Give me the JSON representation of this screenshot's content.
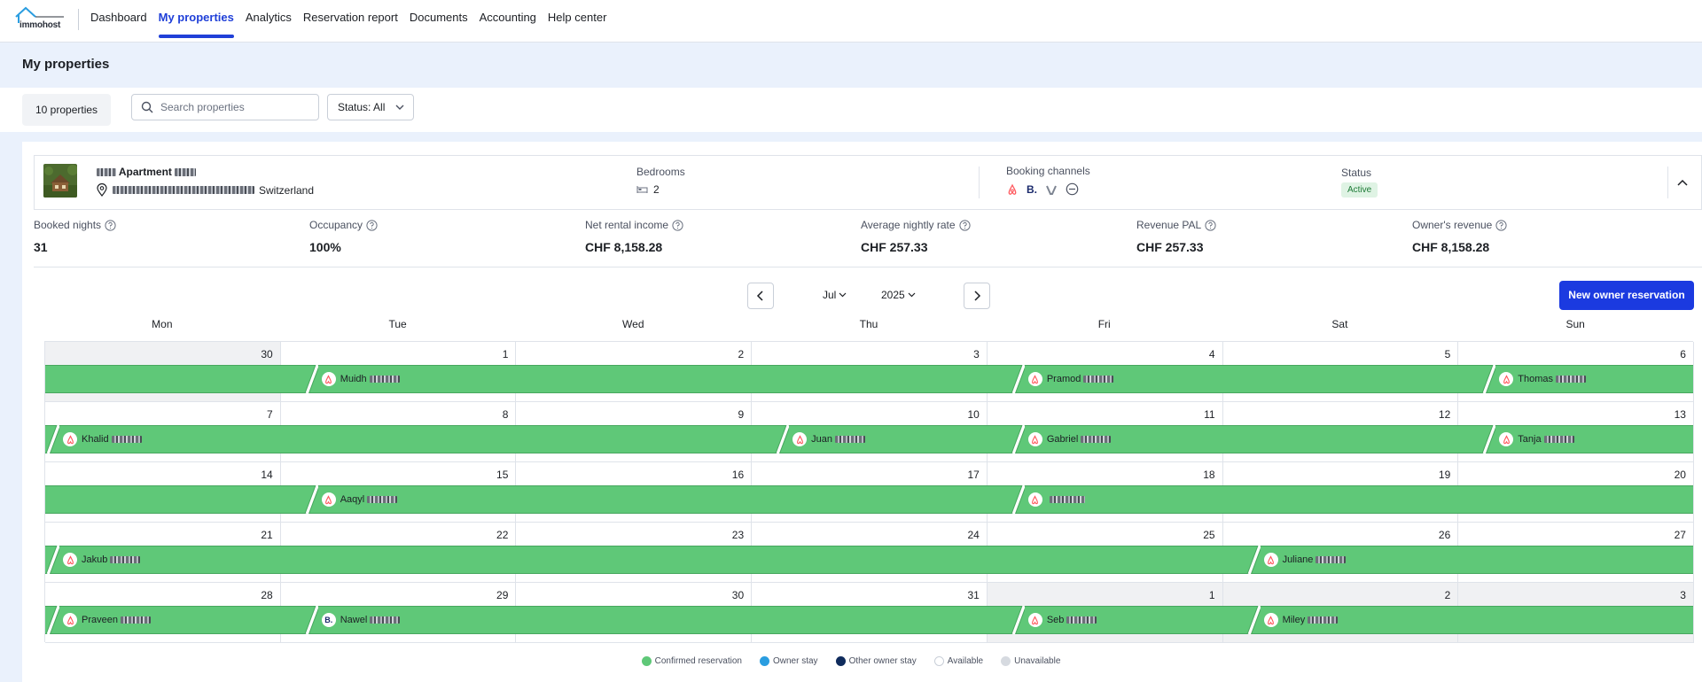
{
  "nav": {
    "logo_text": "immohost",
    "items": [
      {
        "label": "Dashboard",
        "active": false
      },
      {
        "label": "My properties",
        "active": true
      },
      {
        "label": "Analytics",
        "active": false
      },
      {
        "label": "Reservation report",
        "active": false
      },
      {
        "label": "Documents",
        "active": false
      },
      {
        "label": "Accounting",
        "active": false
      },
      {
        "label": "Help center",
        "active": false
      }
    ]
  },
  "page": {
    "title": "My properties"
  },
  "toolbar": {
    "count_label": "10 properties",
    "search_placeholder": "Search properties",
    "status_filter": "Status: All"
  },
  "property": {
    "name": "Apartment",
    "country": "Switzerland",
    "bedrooms_label": "Bedrooms",
    "bedrooms": "2",
    "channels_label": "Booking channels",
    "channels": [
      "airbnb-icon",
      "booking-icon",
      "vrbo-icon",
      "other-channel-icon"
    ],
    "channel_booking_letter": "B.",
    "status_label": "Status",
    "status": "Active"
  },
  "metrics": [
    {
      "label": "Booked nights",
      "value": "31"
    },
    {
      "label": "Occupancy",
      "value": "100%"
    },
    {
      "label": "Net rental income",
      "value": "CHF 8,158.28"
    },
    {
      "label": "Average nightly rate",
      "value": "CHF 257.33"
    },
    {
      "label": "Revenue PAL",
      "value": "CHF 257.33"
    },
    {
      "label": "Owner's revenue",
      "value": "CHF 8,158.28"
    }
  ],
  "calendar": {
    "month": "Jul",
    "year": "2025",
    "new_reservation_label": "New owner reservation",
    "weekdays": [
      "Mon",
      "Tue",
      "Wed",
      "Thu",
      "Fri",
      "Sat",
      "Sun"
    ],
    "weeks": [
      [
        {
          "d": "30",
          "out": true
        },
        {
          "d": "1"
        },
        {
          "d": "2"
        },
        {
          "d": "3"
        },
        {
          "d": "4"
        },
        {
          "d": "5"
        },
        {
          "d": "6"
        }
      ],
      [
        {
          "d": "7"
        },
        {
          "d": "8"
        },
        {
          "d": "9"
        },
        {
          "d": "10"
        },
        {
          "d": "11"
        },
        {
          "d": "12"
        },
        {
          "d": "13"
        }
      ],
      [
        {
          "d": "14"
        },
        {
          "d": "15"
        },
        {
          "d": "16"
        },
        {
          "d": "17"
        },
        {
          "d": "18"
        },
        {
          "d": "19"
        },
        {
          "d": "20"
        }
      ],
      [
        {
          "d": "21"
        },
        {
          "d": "22"
        },
        {
          "d": "23"
        },
        {
          "d": "24"
        },
        {
          "d": "25"
        },
        {
          "d": "26"
        },
        {
          "d": "27"
        }
      ],
      [
        {
          "d": "28"
        },
        {
          "d": "29"
        },
        {
          "d": "30"
        },
        {
          "d": "31"
        },
        {
          "d": "1",
          "out": true
        },
        {
          "d": "2",
          "out": true
        },
        {
          "d": "3",
          "out": true
        }
      ]
    ],
    "reservations": [
      {
        "week": 0,
        "startCol": 1,
        "guest": "Muidh",
        "channel": "airbnb"
      },
      {
        "week": 0,
        "startCol": 4,
        "guest": "Pramod",
        "channel": "airbnb"
      },
      {
        "week": 0,
        "startCol": 6,
        "guest": "Thomas",
        "channel": "airbnb"
      },
      {
        "week": 1,
        "startCol": 0,
        "guest": "Khalid",
        "channel": "airbnb"
      },
      {
        "week": 1,
        "startCol": 3,
        "guest": "Juan",
        "channel": "airbnb"
      },
      {
        "week": 1,
        "startCol": 4,
        "guest": "Gabriel",
        "channel": "airbnb"
      },
      {
        "week": 1,
        "startCol": 6,
        "guest": "Tanja",
        "channel": "airbnb"
      },
      {
        "week": 2,
        "startCol": 1,
        "guest": "Aaqyl",
        "channel": "airbnb"
      },
      {
        "week": 2,
        "startCol": 4,
        "guest": "",
        "channel": "airbnb"
      },
      {
        "week": 3,
        "startCol": 0,
        "guest": "Jakub",
        "channel": "airbnb"
      },
      {
        "week": 3,
        "startCol": 5,
        "guest": "Juliane",
        "channel": "airbnb"
      },
      {
        "week": 4,
        "startCol": 0,
        "guest": "Praveen",
        "channel": "airbnb"
      },
      {
        "week": 4,
        "startCol": 1,
        "guest": "Nawel",
        "channel": "booking"
      },
      {
        "week": 4,
        "startCol": 4,
        "guest": "Seb",
        "channel": "airbnb"
      },
      {
        "week": 4,
        "startCol": 5,
        "guest": "Miley",
        "channel": "airbnb"
      }
    ]
  },
  "legend": [
    {
      "label": "Confirmed reservation",
      "color": "#5fc878"
    },
    {
      "label": "Owner stay",
      "color": "#2a9de0"
    },
    {
      "label": "Other owner stay",
      "color": "#0f2b5c"
    },
    {
      "label": "Available",
      "color": "#ffffff"
    },
    {
      "label": "Unavailable",
      "color": "#d6dae0"
    }
  ]
}
